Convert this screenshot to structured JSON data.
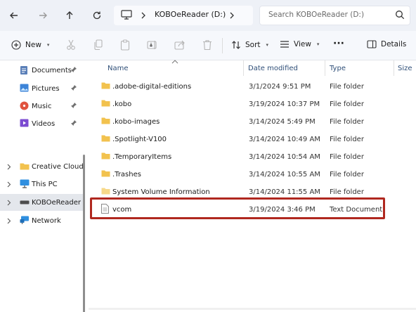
{
  "address": {
    "location": "KOBOeReader (D:)",
    "search_placeholder": "Search KOBOeReader (D:)"
  },
  "toolbar": {
    "new_label": "New",
    "sort_label": "Sort",
    "view_label": "View",
    "more_label": "···",
    "details_label": "Details"
  },
  "sidebar": {
    "quick_access": [
      {
        "label": "Documents",
        "icon": "documents-icon"
      },
      {
        "label": "Pictures",
        "icon": "pictures-icon"
      },
      {
        "label": "Music",
        "icon": "music-icon"
      },
      {
        "label": "Videos",
        "icon": "videos-icon"
      }
    ],
    "tree": [
      {
        "label": "Creative Cloud F",
        "icon": "folder-icon"
      },
      {
        "label": "This PC",
        "icon": "this-pc-icon"
      },
      {
        "label": "KOBOeReader (D",
        "icon": "drive-icon"
      },
      {
        "label": "Network",
        "icon": "network-icon"
      }
    ]
  },
  "columns": {
    "name": "Name",
    "date": "Date modified",
    "type": "Type",
    "size": "Size"
  },
  "files": [
    {
      "name": ".adobe-digital-editions",
      "date": "3/1/2024 9:51 PM",
      "type": "File folder",
      "kind": "folder"
    },
    {
      "name": ".kobo",
      "date": "3/19/2024 10:37 PM",
      "type": "File folder",
      "kind": "folder"
    },
    {
      "name": ".kobo-images",
      "date": "3/14/2024 5:49 PM",
      "type": "File folder",
      "kind": "folder"
    },
    {
      "name": ".Spotlight-V100",
      "date": "3/14/2024 10:49 AM",
      "type": "File folder",
      "kind": "folder"
    },
    {
      "name": ".TemporaryItems",
      "date": "3/14/2024 10:54 AM",
      "type": "File folder",
      "kind": "folder"
    },
    {
      "name": ".Trashes",
      "date": "3/14/2024 10:55 AM",
      "type": "File folder",
      "kind": "folder"
    },
    {
      "name": "System Volume Information",
      "date": "3/14/2024 11:55 AM",
      "type": "File folder",
      "kind": "folder"
    },
    {
      "name": "vcom",
      "date": "3/19/2024 3:46 PM",
      "type": "Text Document",
      "kind": "file"
    }
  ],
  "colors": {
    "highlight": "#b0281f",
    "folder": "#f2c24e",
    "accent": "#1f5fbf"
  }
}
